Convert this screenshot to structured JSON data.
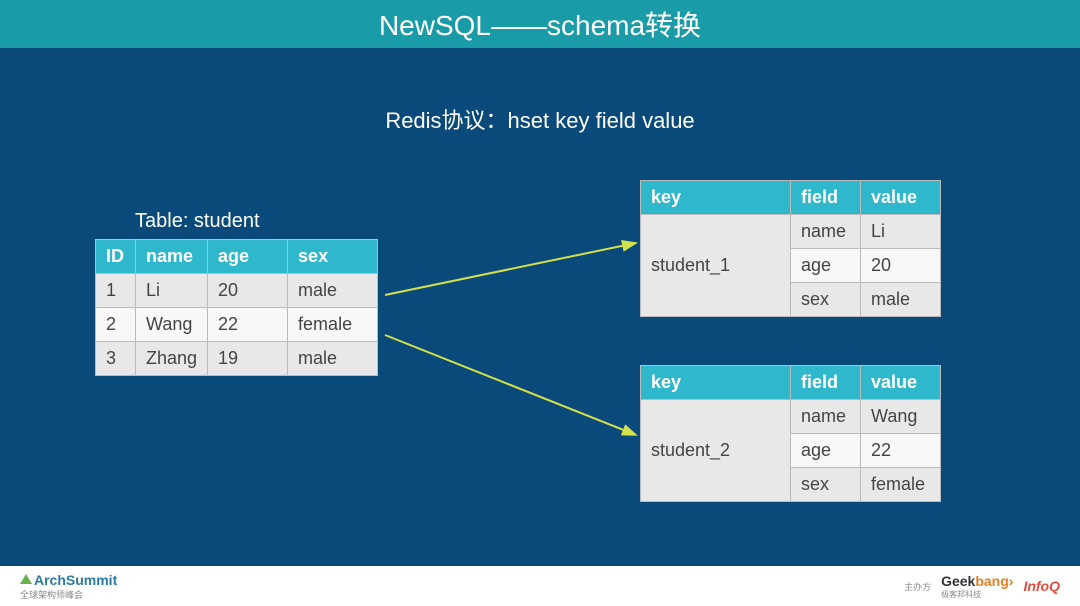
{
  "title": "NewSQL——schema转换",
  "subtitle": "Redis协议：hset key field value",
  "left_table": {
    "caption": "Table: student",
    "headers": [
      "ID",
      "name",
      "age",
      "sex"
    ],
    "rows": [
      [
        "1",
        "Li",
        "20",
        "male"
      ],
      [
        "2",
        "Wang",
        "22",
        "female"
      ],
      [
        "3",
        "Zhang",
        "19",
        "male"
      ]
    ]
  },
  "right_tables": [
    {
      "headers": [
        "key",
        "field",
        "value"
      ],
      "key": "student_1",
      "pairs": [
        [
          "name",
          "Li"
        ],
        [
          "age",
          "20"
        ],
        [
          "sex",
          "male"
        ]
      ]
    },
    {
      "headers": [
        "key",
        "field",
        "value"
      ],
      "key": "student_2",
      "pairs": [
        [
          "name",
          "Wang"
        ],
        [
          "age",
          "22"
        ],
        [
          "sex",
          "female"
        ]
      ]
    }
  ],
  "footer": {
    "left_main": "ArchSummit",
    "left_sub": "全球架构师峰会",
    "right_small": "主办方",
    "geek": "Geek",
    "bang": "bang›",
    "geek_sub": "极客邦科技",
    "infoq": "InfoQ"
  }
}
